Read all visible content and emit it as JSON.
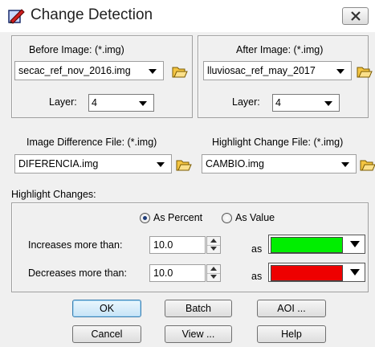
{
  "window": {
    "title": "Change Detection"
  },
  "before": {
    "label": "Before Image: (*.img)",
    "file": "secac_ref_nov_2016.img",
    "layer_label": "Layer:",
    "layer_value": "4"
  },
  "after": {
    "label": "After Image: (*.img)",
    "file": "lluviosac_ref_may_2017",
    "layer_label": "Layer:",
    "layer_value": "4"
  },
  "difference": {
    "label": "Image Difference File: (*.img)",
    "file": "DIFERENCIA.img"
  },
  "highlight_file": {
    "label": "Highlight Change File: (*.img)",
    "file": "CAMBIO.img"
  },
  "highlight": {
    "label": "Highlight Changes:",
    "radio_percent": "As Percent",
    "radio_value": "As Value",
    "selected": "As Percent",
    "increase_label": "Increases more than:",
    "increase_value": "10.0",
    "increase_as": "as",
    "increase_color": "#00ee00",
    "decrease_label": "Decreases more than:",
    "decrease_value": "10.0",
    "decrease_as": "as",
    "decrease_color": "#ee0000"
  },
  "buttons": {
    "ok": "OK",
    "batch": "Batch",
    "aoi": "AOI ...",
    "cancel": "Cancel",
    "view": "View ...",
    "help": "Help"
  }
}
